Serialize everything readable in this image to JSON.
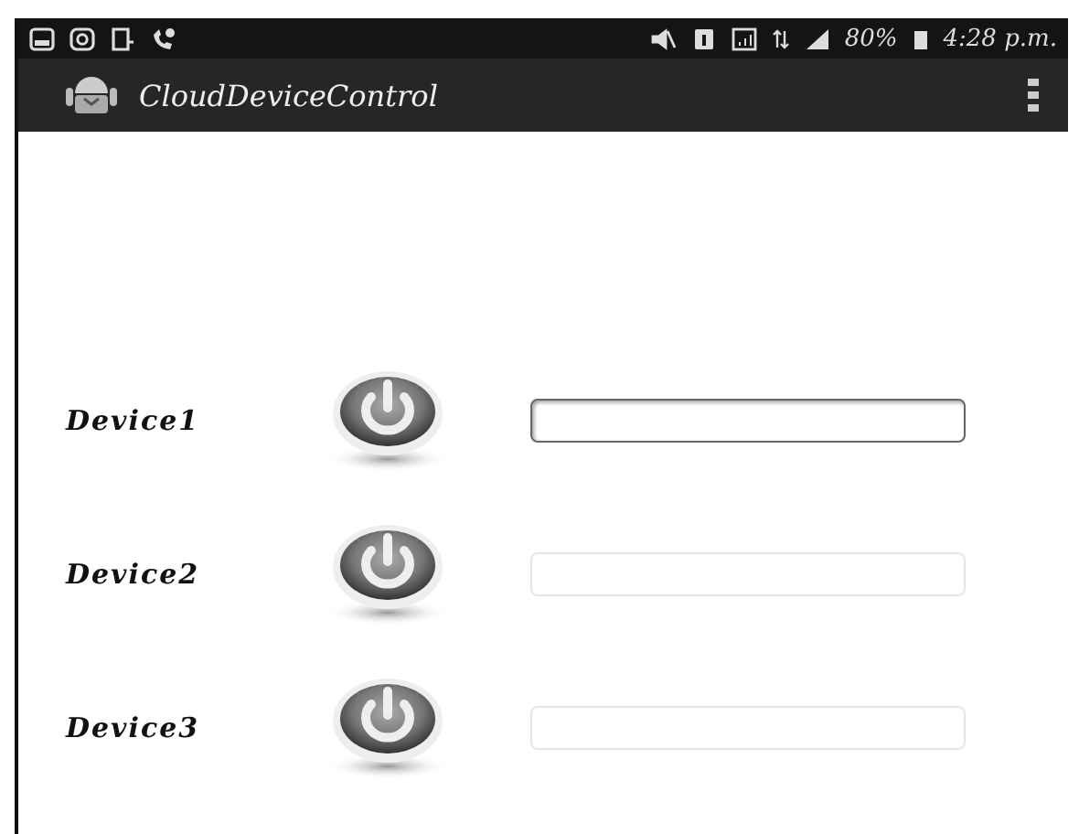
{
  "status_bar": {
    "battery": "80%",
    "time": "4:28 p.m."
  },
  "app_bar": {
    "title": "CloudDeviceControl"
  },
  "devices": [
    {
      "label": "Device1",
      "focused": true
    },
    {
      "label": "Device2",
      "focused": false
    },
    {
      "label": "Device3",
      "focused": false
    }
  ]
}
